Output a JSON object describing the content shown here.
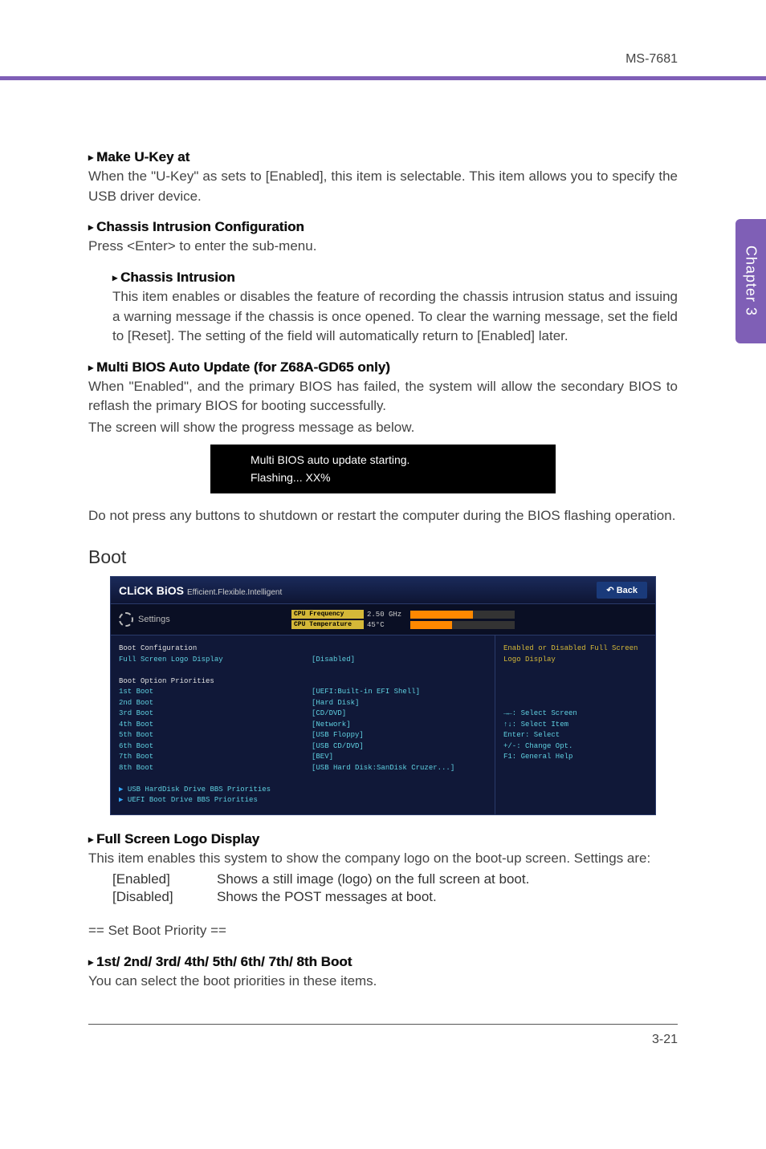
{
  "header": {
    "code": "MS-7681"
  },
  "sideTab": {
    "label": "Chapter 3"
  },
  "sec1": {
    "h": "Make U-Key at",
    "b": "When the \"U-Key\" as sets to [Enabled], this item is selectable. This item allows you to specify the USB driver device."
  },
  "sec2": {
    "h": "Chassis Intrusion Configuration",
    "b": "Press <Enter> to enter the sub-menu."
  },
  "sec2a": {
    "h": "Chassis Intrusion",
    "b": "This item enables or disables the feature of recording the chassis intrusion status and issuing a warning message if the chassis is once opened. To clear the warning message, set the field to [Reset]. The setting of the field will automatically return to [Enabled] later."
  },
  "sec3": {
    "h": "Multi BIOS Auto Update (for Z68A-GD65 only)",
    "b1": "When \"Enabled\", and the primary BIOS has failed, the system will allow the secondary BIOS to reflash the primary BIOS for booting successfully.",
    "b2": "The screen will show the progress message as below.",
    "console1": "Multi BIOS auto update starting.",
    "console2": "Flashing... XX%",
    "b3": "Do not press any buttons to shutdown or restart the computer during the BIOS flashing operation."
  },
  "bootTitle": "Boot",
  "shot": {
    "brand1": "CLiCK",
    "brand2": "BiOS",
    "brand3": "Efficient.Flexible.Intelligent",
    "back": "Back",
    "settings": "Settings",
    "stat1l": "CPU Frequency",
    "stat1v": "2.50 GHz",
    "stat2l": "CPU Temperature",
    "stat2v": "45°C",
    "m_conf": "Boot Configuration",
    "m_logo": "Full Screen Logo Display",
    "m_logo_v": "[Disabled]",
    "m_prio": "Boot Option Priorities",
    "m1": "1st Boot",
    "m1v": "[UEFI:Built-in EFI Shell]",
    "m2": "2nd Boot",
    "m2v": "[Hard Disk]",
    "m3": "3rd Boot",
    "m3v": "[CD/DVD]",
    "m4": "4th Boot",
    "m4v": "[Network]",
    "m5": "5th Boot",
    "m5v": "[USB Floppy]",
    "m6": "6th Boot",
    "m6v": "[USB CD/DVD]",
    "m7": "7th Boot",
    "m7v": "[BEV]",
    "m8": "8th Boot",
    "m8v": "[USB Hard Disk:SanDisk Cruzer...]",
    "mh1": "USB HardDisk Drive BBS Priorities",
    "mh2": "UEFI Boot Drive BBS Priorities",
    "s_help1": "Enabled or Disabled Full Screen Logo Display",
    "s_k1": "→←: Select Screen",
    "s_k2": "↑↓: Select Item",
    "s_k3": "Enter: Select",
    "s_k4": "+/-: Change Opt.",
    "s_k5": "F1: General Help"
  },
  "sec4": {
    "h": "Full Screen Logo Display",
    "b": "This item enables this system to show the company logo on the boot-up screen. Settings are:",
    "opt1k": "[Enabled]",
    "opt1v": "Shows a still image (logo) on the full screen at boot.",
    "opt2k": "[Disabled]",
    "opt2v": "Shows the POST messages at boot."
  },
  "sec5": {
    "label": "== Set Boot Priority =="
  },
  "sec6": {
    "h": "1st/ 2nd/ 3rd/ 4th/ 5th/ 6th/ 7th/ 8th Boot",
    "b": "You can select the boot priorities in these items."
  },
  "footer": {
    "page": "3-21"
  }
}
